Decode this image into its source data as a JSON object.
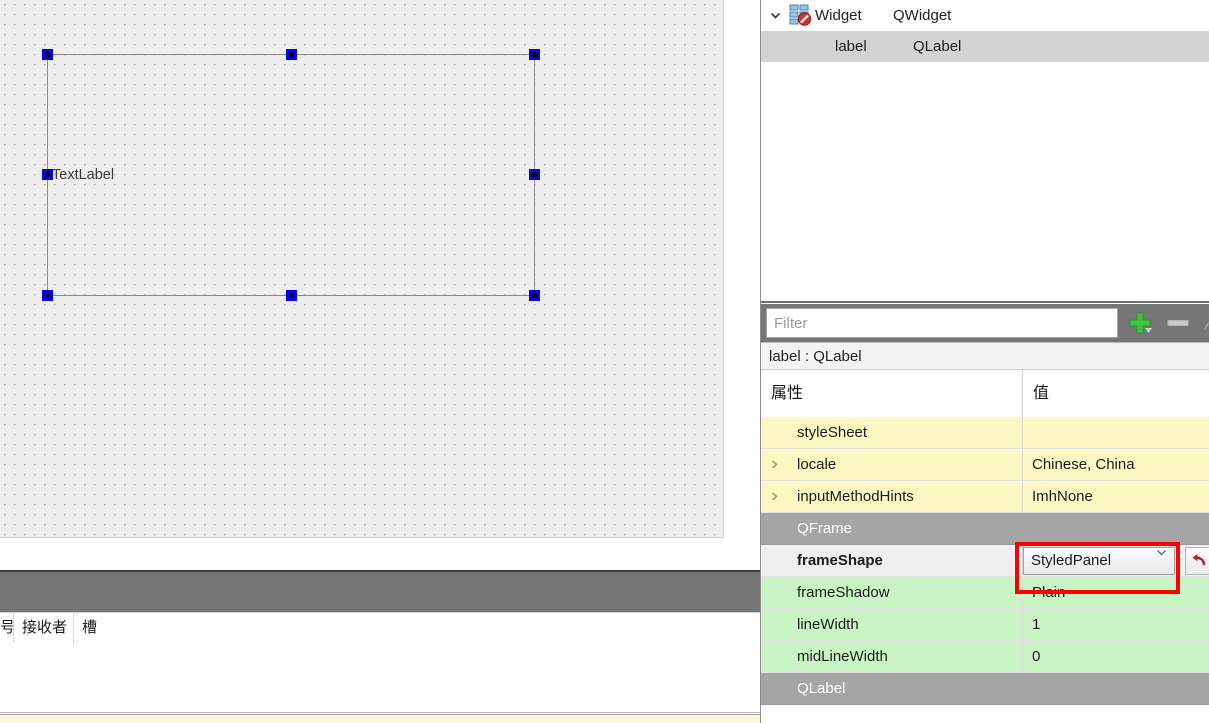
{
  "designer": {
    "widget_label_text": "TextLabel",
    "selection_handles": 8
  },
  "object_tree": {
    "rows": [
      {
        "twisty": "chevron-down",
        "icon": "widget-disabled-icon",
        "name": "Widget",
        "class": "QWidget",
        "selected": false,
        "indent": 0
      },
      {
        "twisty": "",
        "icon": "",
        "name": "label",
        "class": "QLabel",
        "selected": true,
        "indent": 1
      }
    ]
  },
  "filter": {
    "placeholder": "Filter",
    "value": "",
    "add_label": "+",
    "remove_label": "−",
    "config_label": "◠"
  },
  "object_label": "label : QLabel",
  "property_table": {
    "columns": [
      "属性",
      "值"
    ],
    "rows": [
      {
        "kind": "prop",
        "group": "yellow",
        "expandable": false,
        "name": "styleSheet",
        "value": "",
        "bold": false
      },
      {
        "kind": "prop",
        "group": "yellow",
        "expandable": true,
        "name": "locale",
        "value": "Chinese, China",
        "bold": false
      },
      {
        "kind": "prop",
        "group": "yellow",
        "expandable": true,
        "name": "inputMethodHints",
        "value": "ImhNone",
        "bold": false
      },
      {
        "kind": "group",
        "group": "gray",
        "expandable": false,
        "name": "QFrame",
        "value": "",
        "bold": false
      },
      {
        "kind": "prop",
        "group": "editing",
        "expandable": false,
        "name": "frameShape",
        "value": "StyledPanel",
        "bold": true,
        "editor": "combobox",
        "reset_button": true
      },
      {
        "kind": "prop",
        "group": "green",
        "expandable": false,
        "name": "frameShadow",
        "value": "Plain",
        "bold": false
      },
      {
        "kind": "prop",
        "group": "green",
        "expandable": false,
        "name": "lineWidth",
        "value": "1",
        "bold": false
      },
      {
        "kind": "prop",
        "group": "green",
        "expandable": false,
        "name": "midLineWidth",
        "value": "0",
        "bold": false
      },
      {
        "kind": "group",
        "group": "gray",
        "expandable": false,
        "name": "QLabel",
        "value": "",
        "bold": false
      }
    ]
  },
  "signal_editor": {
    "columns": [
      "号",
      "接收者",
      "槽"
    ],
    "rows": []
  },
  "colors": {
    "group_header_bg": "#a6a6a6",
    "qwidget_group_row_bg": "#fbf8c4",
    "qframe_group_row_bg": "#c9f5c5",
    "toolbar_bg": "#767676",
    "canvas_bg": "#eeeeee",
    "selection_handle": "#0000ff",
    "highlight_rect": "#ff0000",
    "add_icon": "#3ec63e",
    "reset_icon": "#c21b1b"
  }
}
